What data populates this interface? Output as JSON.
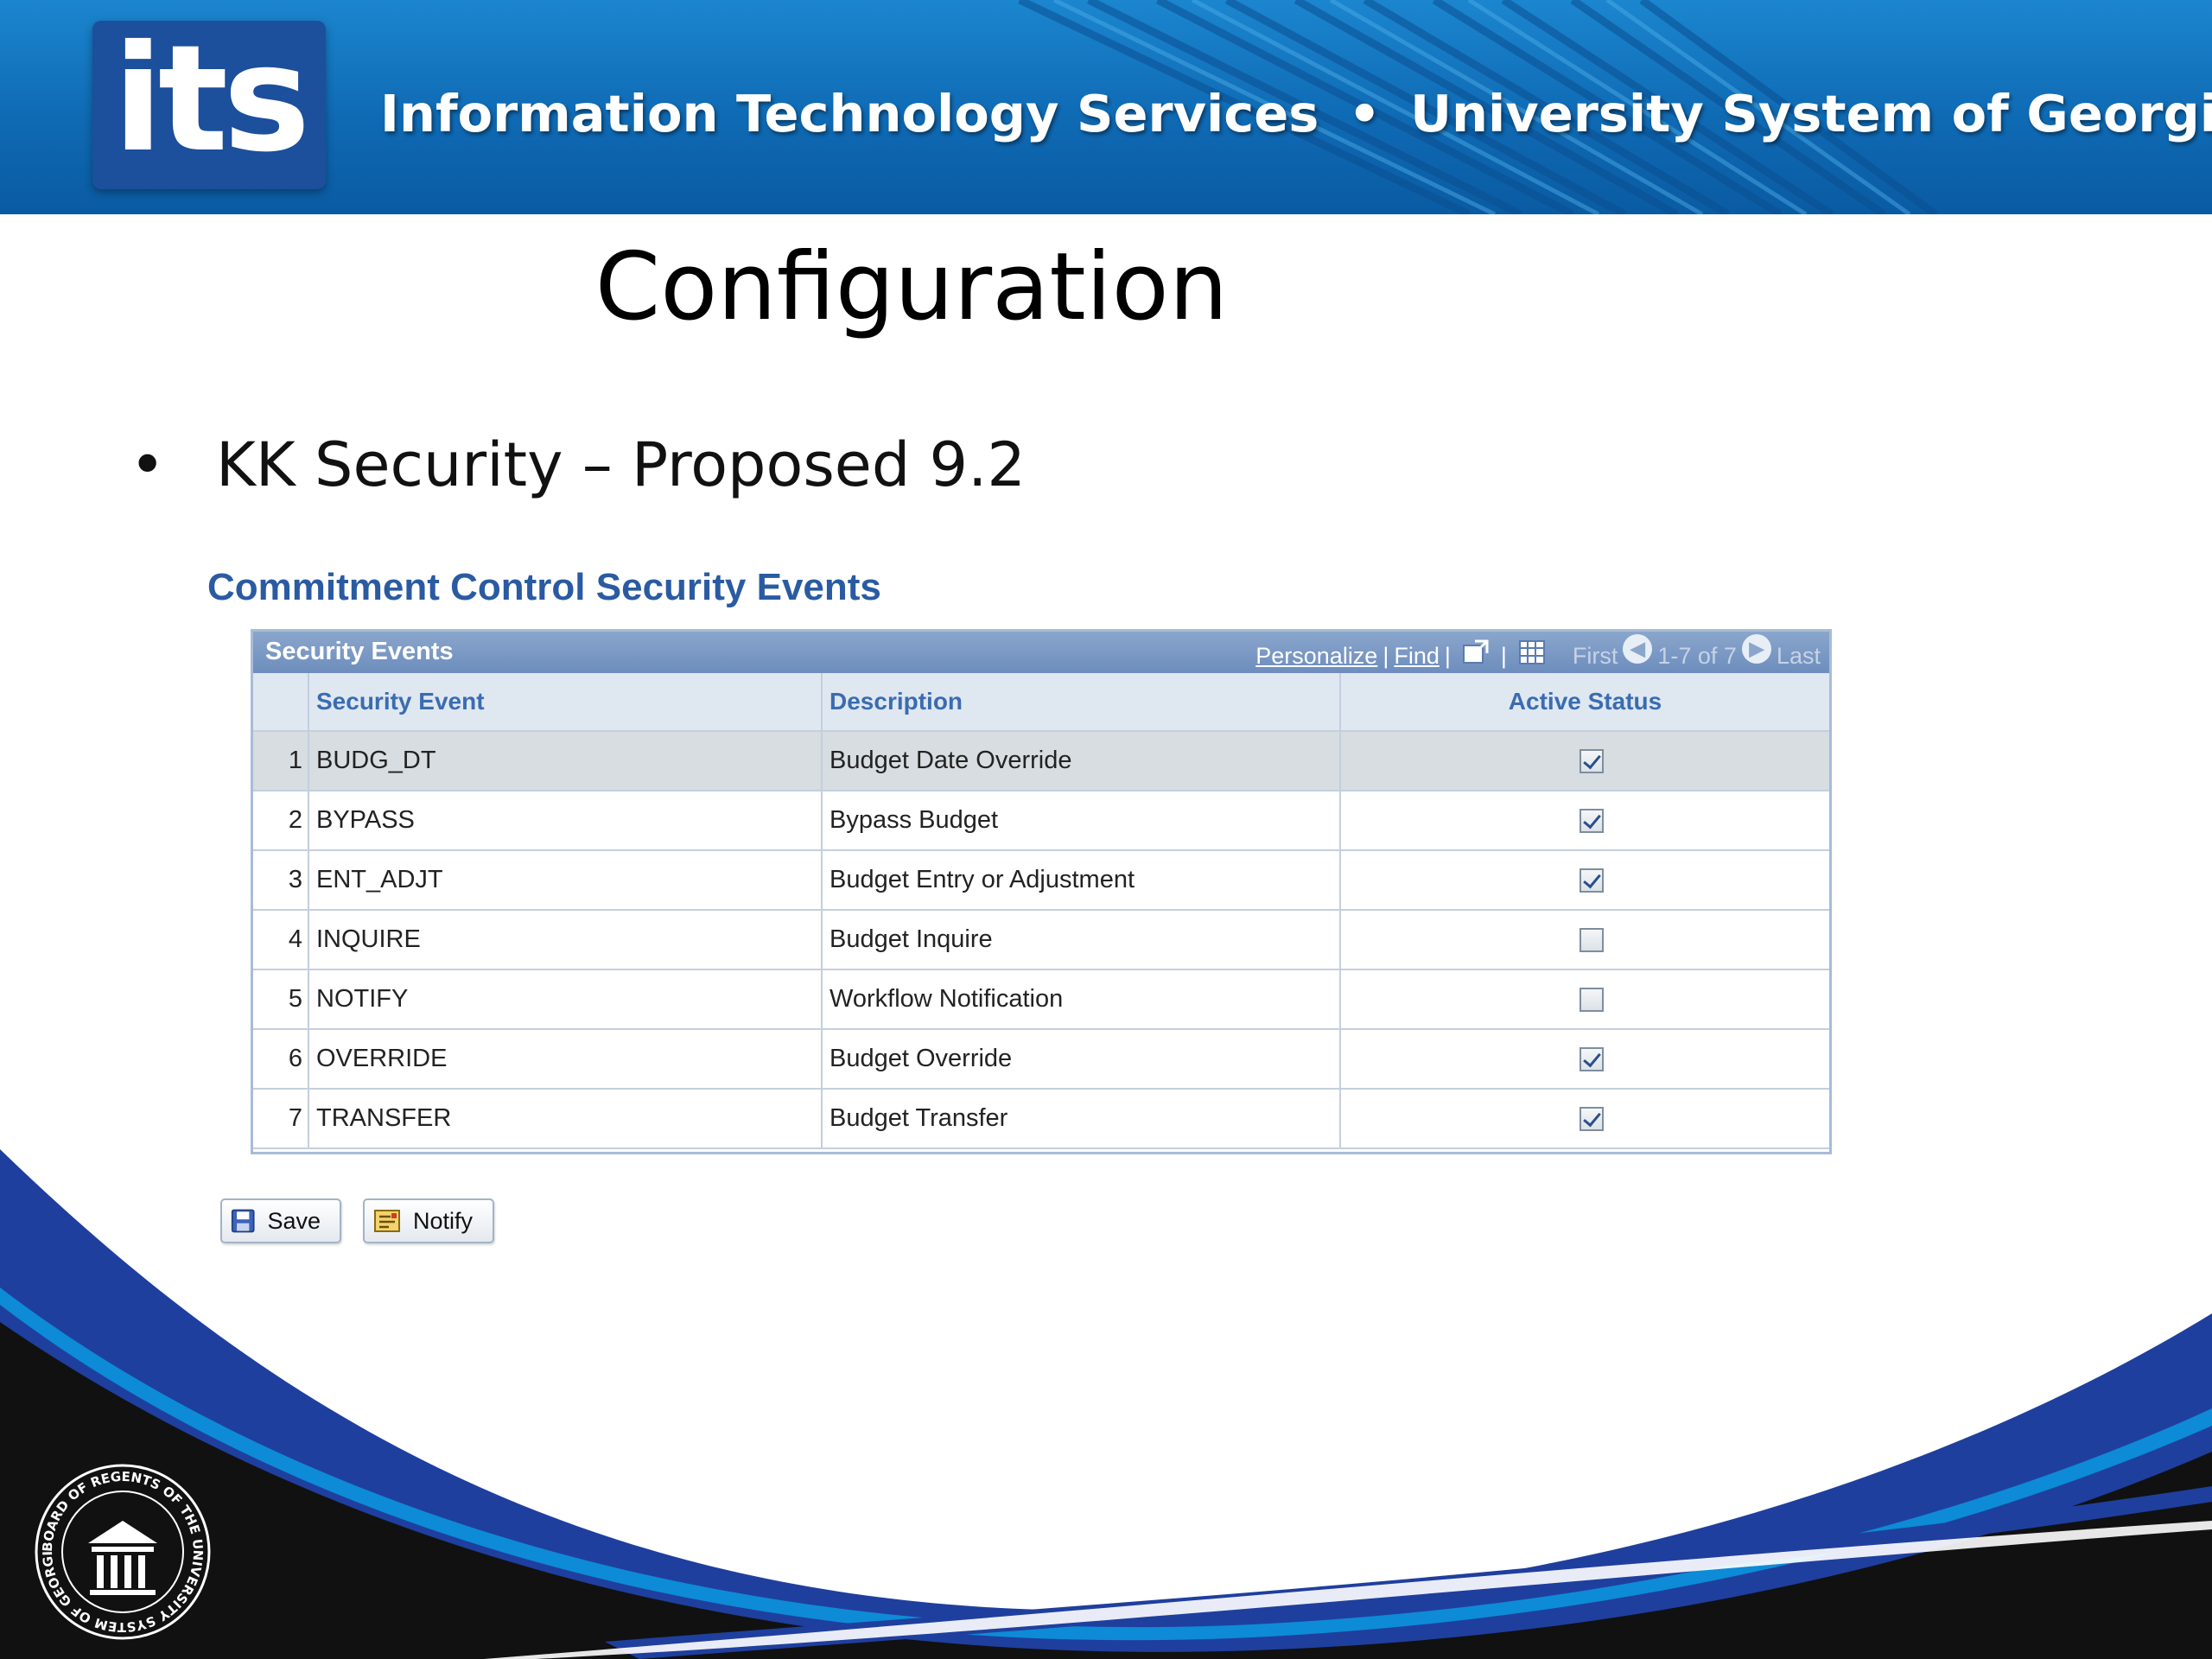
{
  "banner": {
    "logo": "its",
    "org_name": "Information Technology Services",
    "separator": "•",
    "system_name": "University System of Georgia"
  },
  "slide": {
    "title": "Configuration",
    "bullet_symbol": "•",
    "bullet_text": "KK Security – Proposed 9.2"
  },
  "page": {
    "title": "Commitment Control Security Events"
  },
  "grid": {
    "caption": "Security Events",
    "nav": {
      "personalize": "Personalize",
      "find": "Find",
      "divider": "|",
      "first": "First",
      "range": "1-7 of 7",
      "last": "Last",
      "icons": [
        "view-all-icon",
        "download-icon",
        "prev-arrow-icon",
        "next-arrow-icon"
      ]
    },
    "columns": [
      "Security Event",
      "Description",
      "Active Status"
    ],
    "rows": [
      {
        "num": "1",
        "event": "BUDG_DT",
        "description": "Budget Date Override",
        "active": true
      },
      {
        "num": "2",
        "event": "BYPASS",
        "description": "Bypass Budget",
        "active": true
      },
      {
        "num": "3",
        "event": "ENT_ADJT",
        "description": "Budget Entry or Adjustment",
        "active": true
      },
      {
        "num": "4",
        "event": "INQUIRE",
        "description": "Budget Inquire",
        "active": false
      },
      {
        "num": "5",
        "event": "NOTIFY",
        "description": "Workflow Notification",
        "active": false
      },
      {
        "num": "6",
        "event": "OVERRIDE",
        "description": "Budget Override",
        "active": true
      },
      {
        "num": "7",
        "event": "TRANSFER",
        "description": "Budget Transfer",
        "active": true
      }
    ]
  },
  "toolbar": {
    "save_label": "Save",
    "notify_label": "Notify"
  },
  "footer": {
    "seal_text": "BOARD OF REGENTS OF THE UNIVERSITY SYSTEM OF GEORGIA",
    "colors": {
      "blue": "#1f3f9e",
      "black": "#111111"
    }
  }
}
